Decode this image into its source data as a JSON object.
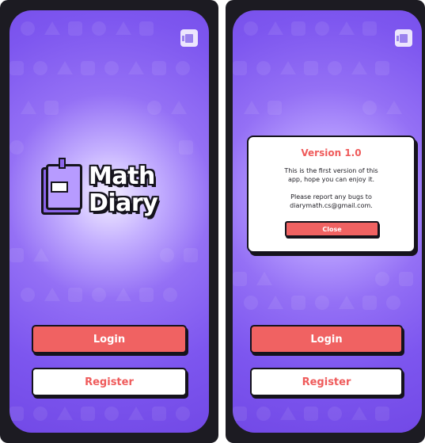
{
  "left_screen": {
    "app_name_line1": "Math",
    "app_name_line2": "Diary",
    "login_label": "Login",
    "register_label": "Register"
  },
  "right_screen": {
    "dialog": {
      "title": "Version 1.0",
      "line1": "This is the first version of this",
      "line2": "app, hope you can enjoy it.",
      "line3": "Please report any bugs to",
      "line4": "diarymath.cs@gmail.com.",
      "close_label": "Close"
    },
    "login_label": "Login",
    "register_label": "Register"
  },
  "colors": {
    "background_purple": "#7d56ef",
    "accent_red": "#f06262",
    "text_red": "#ef5b5b",
    "outline": "#15131c"
  },
  "icons": {
    "corner": "window-toggle-icon",
    "logo": "book-icon"
  }
}
